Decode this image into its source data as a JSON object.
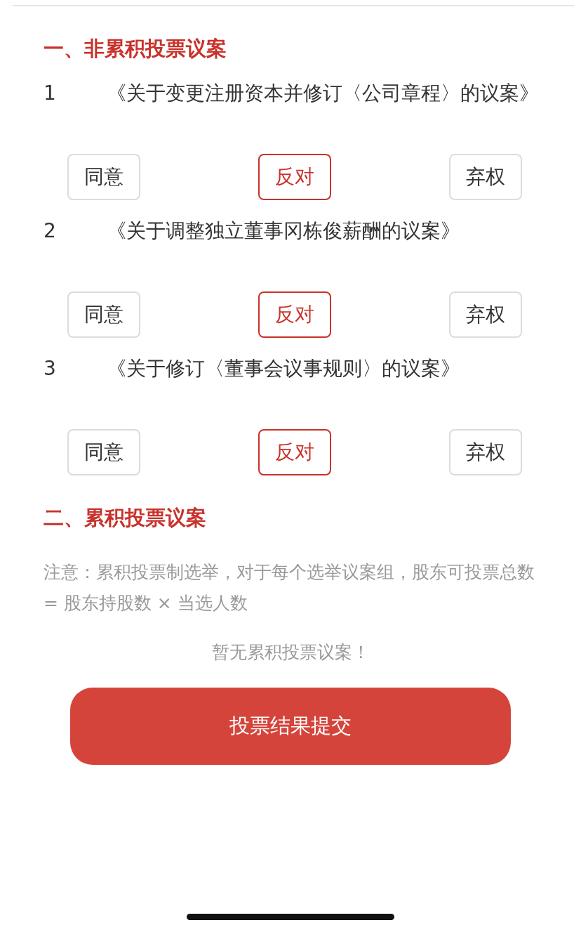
{
  "sections": [
    {
      "title": "一、非累积投票议案",
      "kind": "proposals",
      "proposals": [
        {
          "number": "1",
          "title": "《关于变更注册资本并修订〈公司章程〉的议案》",
          "options": [
            {
              "label": "同意",
              "selected": false
            },
            {
              "label": "反对",
              "selected": true
            },
            {
              "label": "弃权",
              "selected": false
            }
          ]
        },
        {
          "number": "2",
          "title": "《关于调整独立董事冈栋俊薪酬的议案》",
          "options": [
            {
              "label": "同意",
              "selected": false
            },
            {
              "label": "反对",
              "selected": true
            },
            {
              "label": "弃权",
              "selected": false
            }
          ]
        },
        {
          "number": "3",
          "title": "《关于修订〈董事会议事规则〉的议案》",
          "options": [
            {
              "label": "同意",
              "selected": false
            },
            {
              "label": "反对",
              "selected": true
            },
            {
              "label": "弃权",
              "selected": false
            }
          ]
        }
      ]
    },
    {
      "title": "二、累积投票议案",
      "kind": "cumulative",
      "note": "注意：累积投票制选举，对于每个选举议案组，股东可投票总数 = 股东持股数 × 当选人数",
      "empty_text": "暂无累积投票议案！"
    }
  ],
  "submit_button": "投票结果提交"
}
